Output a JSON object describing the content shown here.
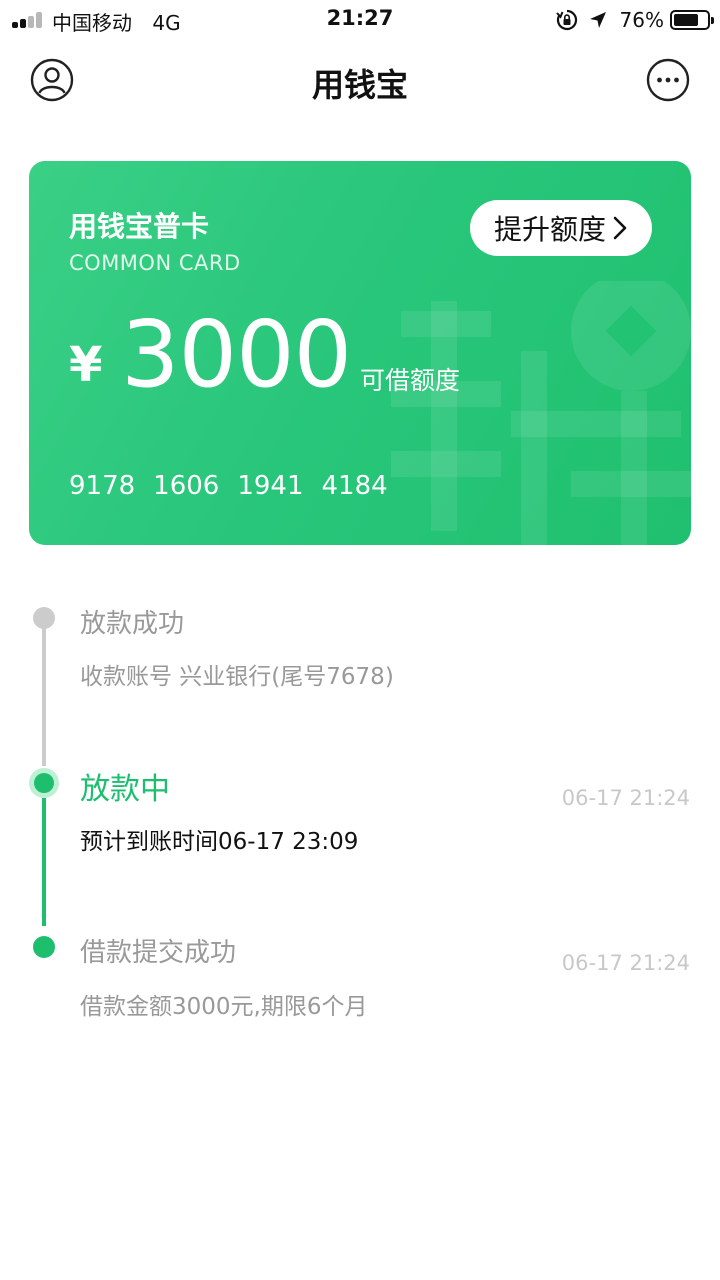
{
  "status_bar": {
    "carrier": "中国移动",
    "network": "4G",
    "time": "21:27",
    "battery_percent": "76%",
    "battery_level": 0.76,
    "signal_bars_filled": 2,
    "signal_bars_total": 4
  },
  "nav": {
    "title": "用钱宝",
    "left_icon": "user-icon",
    "right_icon": "more-icon"
  },
  "card": {
    "title": "用钱宝普卡",
    "subtitle": "COMMON CARD",
    "upgrade_label": "提升额度",
    "currency": "¥",
    "amount": "3000",
    "amount_label": "可借额度",
    "number_groups": [
      "9178",
      "1606",
      "1941",
      "4184"
    ],
    "watermark_char": "钱",
    "colors": {
      "gradient_start": "#3ad086",
      "gradient_end": "#1fc06f"
    }
  },
  "timeline": {
    "items": [
      {
        "title": "放款成功",
        "subtitle": "收款账号 兴业银行(尾号7678)",
        "time": "",
        "state": "pending"
      },
      {
        "title": "放款中",
        "subtitle": "预计到账时间06-17 23:09",
        "time": "06-17 21:24",
        "state": "current"
      },
      {
        "title": "借款提交成功",
        "subtitle": "借款金额3000元,期限6个月",
        "time": "06-17 21:24",
        "state": "done"
      }
    ],
    "colors": {
      "active": "#1dbf6f",
      "inactive": "#cccccc",
      "muted_text": "#999999"
    }
  }
}
